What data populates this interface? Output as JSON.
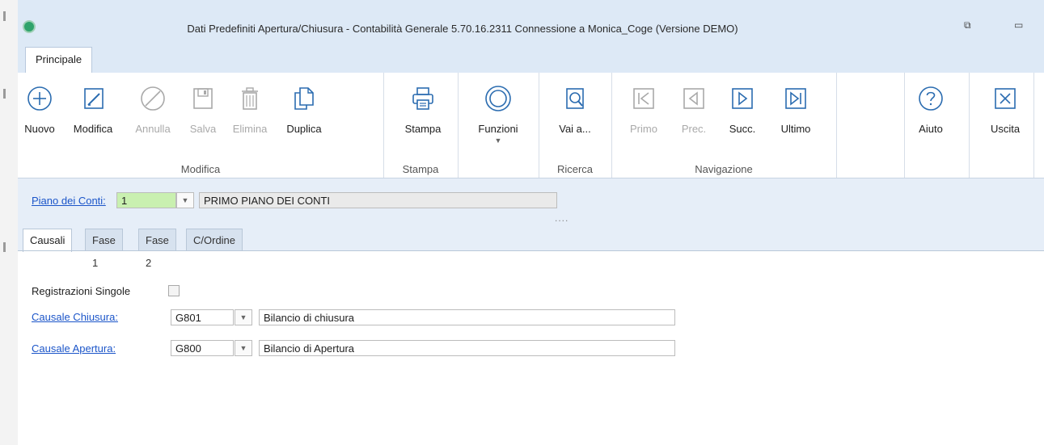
{
  "window": {
    "title": "Dati Predefiniti Apertura/Chiusura - Contabilità Generale 5.70.16.2311  Connessione a Monica_Coge (Versione DEMO)"
  },
  "ribbon": {
    "tab": "Principale",
    "buttons": {
      "nuovo": "Nuovo",
      "modifica": "Modifica",
      "annulla": "Annulla",
      "salva": "Salva",
      "elimina": "Elimina",
      "duplica": "Duplica",
      "stampa": "Stampa",
      "funzioni": "Funzioni",
      "vai": "Vai a...",
      "primo": "Primo",
      "prec": "Prec.",
      "succ": "Succ.",
      "ultimo": "Ultimo",
      "aiuto": "Aiuto",
      "uscita": "Uscita"
    },
    "groups": {
      "modifica": "Modifica",
      "stampa": "Stampa",
      "ricerca": "Ricerca",
      "navigazione": "Navigazione"
    }
  },
  "piano": {
    "label": "Piano dei Conti:",
    "code": "1",
    "description": "PRIMO PIANO DEI CONTI"
  },
  "tabs": [
    "Causali",
    "Fase 1",
    "Fase 2",
    "C/Ordine"
  ],
  "causali": {
    "registrazioni_label": "Registrazioni Singole",
    "chiusura": {
      "label": "Causale Chiusura:",
      "code": "G801",
      "description": "Bilancio di chiusura"
    },
    "apertura": {
      "label": "Causale Apertura:",
      "code": "G800",
      "description": "Bilancio di Apertura"
    }
  },
  "colors": {
    "accent": "#1b55c9",
    "band": "#e6eef8",
    "titlebar": "#dde9f6",
    "code_field": "#c9f0b0",
    "icon_blue": "#2b6cb0",
    "icon_disabled": "#a9a9a9"
  }
}
